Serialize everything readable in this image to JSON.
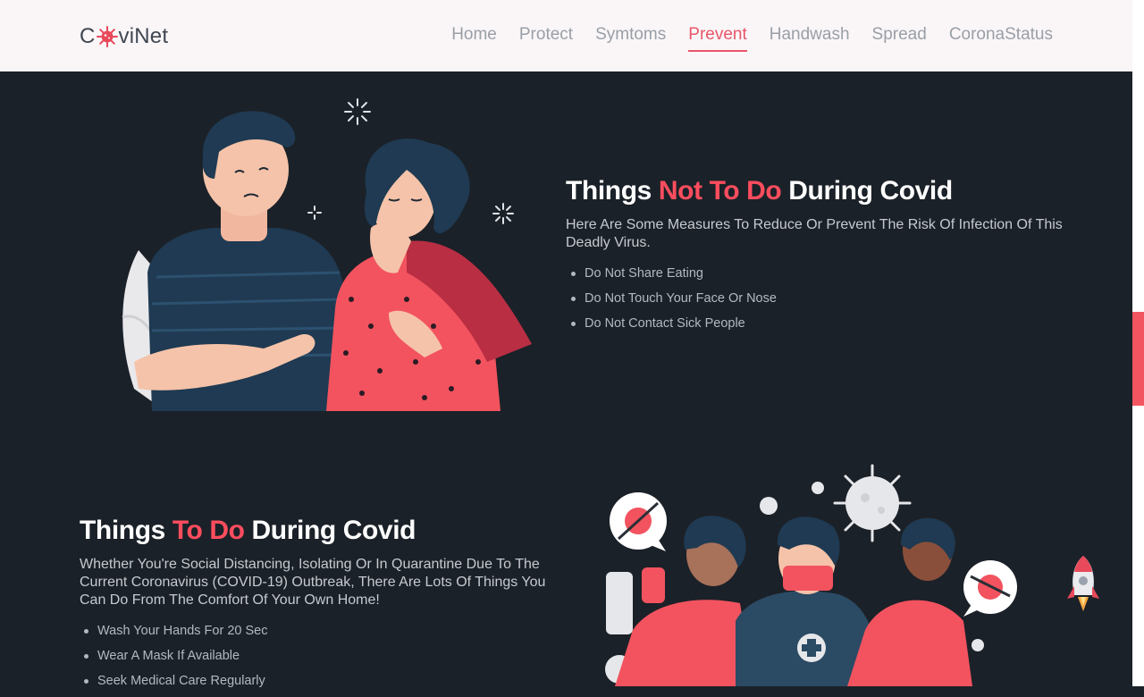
{
  "header": {
    "logo_prefix": "C",
    "logo_suffix": "viNet",
    "logo_icon": "coronavirus-icon",
    "nav": [
      {
        "label": "Home",
        "active": false
      },
      {
        "label": "Protect",
        "active": false
      },
      {
        "label": "Symtoms",
        "active": false
      },
      {
        "label": "Prevent",
        "active": true
      },
      {
        "label": "Handwash",
        "active": false
      },
      {
        "label": "Spread",
        "active": false
      },
      {
        "label": "CoronaStatus",
        "active": false
      }
    ]
  },
  "not_to_do": {
    "title_pre": "Things ",
    "title_hl": "Not To Do",
    "title_post": " During Covid",
    "description": "Here Are Some Measures To Reduce Or Prevent The Risk Of Infection Of This Deadly Virus.",
    "items": [
      "Do Not Share Eating",
      "Do Not Touch Your Face Or Nose",
      "Do Not Contact Sick People"
    ]
  },
  "to_do": {
    "title_pre": "Things ",
    "title_hl": "To Do",
    "title_post": " During Covid",
    "description": "Whether You're Social Distancing, Isolating Or In Quarantine Due To The Current Coronavirus (COVID-19) Outbreak, There Are Lots Of Things You Can Do From The Comfort Of Your Own Home!",
    "items": [
      "Wash Your Hands For 20 Sec",
      "Wear A Mask If Available",
      "Seek Medical Care Regularly"
    ]
  },
  "colors": {
    "accent": "#ff4d5e",
    "background": "#1b2128",
    "header_bg": "#faf6f8"
  },
  "icons": {
    "scroll_top": "rocket-icon"
  }
}
